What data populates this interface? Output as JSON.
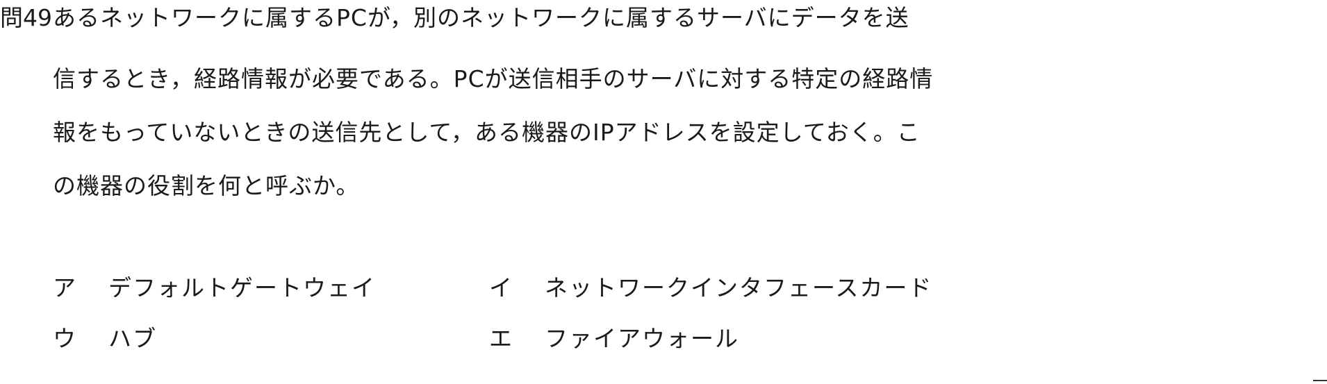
{
  "question": {
    "number": "問49",
    "lines": [
      "あるネットワークに属するPCが，別のネットワークに属するサーバにデータを送",
      "信するとき，経路情報が必要である。PCが送信相手のサーバに対する特定の経路情",
      "報をもっていないときの送信先として，ある機器のIPアドレスを設定しておく。こ",
      "の機器の役割を何と呼ぶか。"
    ]
  },
  "options": [
    {
      "label": "ア",
      "text": "デフォルトゲートウェイ"
    },
    {
      "label": "イ",
      "text": "ネットワークインタフェースカード"
    },
    {
      "label": "ウ",
      "text": "ハブ"
    },
    {
      "label": "エ",
      "text": "ファイアウォール"
    }
  ]
}
